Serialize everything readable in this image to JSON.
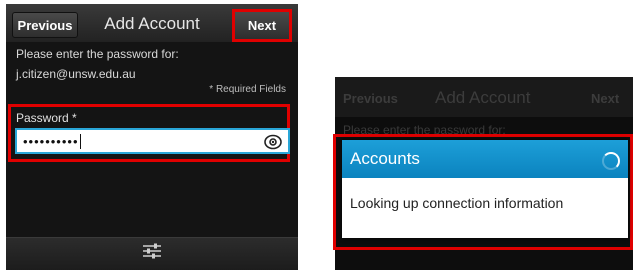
{
  "left": {
    "header": {
      "previous_label": "Previous",
      "title": "Add Account",
      "next_label": "Next"
    },
    "prompt": "Please enter the password for:",
    "email": "j.citizen@unsw.edu.au",
    "required_note": "* Required Fields",
    "password": {
      "label": "Password *",
      "value": "••••••••••"
    },
    "icons": {
      "reveal": "eye-icon",
      "settings": "sliders-icon"
    }
  },
  "right": {
    "header": {
      "previous_label": "Previous",
      "title": "Add Account",
      "next_label": "Next"
    },
    "background_text": "Please enter the password for:",
    "dialog": {
      "title": "Accounts",
      "message": "Looking up connection information",
      "icon": "spinner-icon"
    }
  },
  "colors": {
    "highlight": "#e00000",
    "accent": "#1d9fd8",
    "background": "#141414"
  }
}
